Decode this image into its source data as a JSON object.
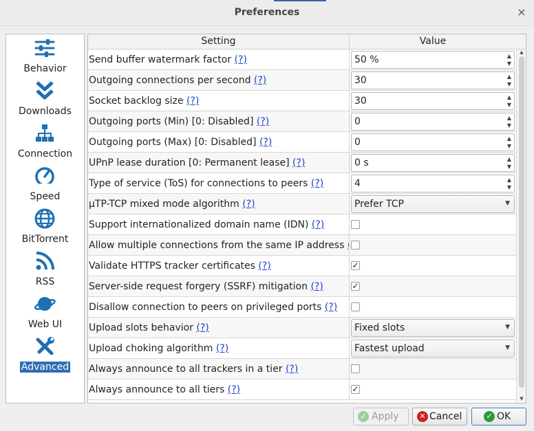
{
  "window": {
    "title": "Preferences",
    "close_glyph": "×"
  },
  "sidebar": {
    "items": [
      {
        "label": "Behavior",
        "icon": "sliders-icon"
      },
      {
        "label": "Downloads",
        "icon": "double-chevron-down-icon"
      },
      {
        "label": "Connection",
        "icon": "network-icon"
      },
      {
        "label": "Speed",
        "icon": "speedometer-icon"
      },
      {
        "label": "BitTorrent",
        "icon": "globe-icon"
      },
      {
        "label": "RSS",
        "icon": "rss-icon"
      },
      {
        "label": "Web UI",
        "icon": "planet-icon"
      },
      {
        "label": "Advanced",
        "icon": "tools-icon",
        "selected": true
      }
    ]
  },
  "table": {
    "headers": {
      "setting": "Setting",
      "value": "Value"
    },
    "help_link": "(?)",
    "rows": [
      {
        "label": "Send buffer watermark factor",
        "type": "spin",
        "value": "50 %"
      },
      {
        "label": "Outgoing connections per second",
        "type": "spin",
        "value": "30"
      },
      {
        "label": "Socket backlog size",
        "type": "spin",
        "value": "30"
      },
      {
        "label": "Outgoing ports (Min) [0: Disabled]",
        "type": "spin",
        "value": "0"
      },
      {
        "label": "Outgoing ports (Max) [0: Disabled]",
        "type": "spin",
        "value": "0"
      },
      {
        "label": "UPnP lease duration [0: Permanent lease]",
        "type": "spin",
        "value": "0 s"
      },
      {
        "label": "Type of service (ToS) for connections to peers",
        "type": "spin",
        "value": "4"
      },
      {
        "label": "µTP-TCP mixed mode algorithm",
        "type": "combo",
        "value": "Prefer TCP"
      },
      {
        "label": "Support internationalized domain name (IDN)",
        "type": "check",
        "value": ""
      },
      {
        "label": "Allow multiple connections from the same IP address",
        "type": "check",
        "value": ""
      },
      {
        "label": "Validate HTTPS tracker certificates",
        "type": "check",
        "value": "✓"
      },
      {
        "label": "Server-side request forgery (SSRF) mitigation",
        "type": "check",
        "value": "✓"
      },
      {
        "label": "Disallow connection to peers on privileged ports",
        "type": "check",
        "value": ""
      },
      {
        "label": "Upload slots behavior",
        "type": "combo",
        "value": "Fixed slots"
      },
      {
        "label": "Upload choking algorithm",
        "type": "combo",
        "value": "Fastest upload"
      },
      {
        "label": "Always announce to all trackers in a tier",
        "type": "check",
        "value": ""
      },
      {
        "label": "Always announce to all tiers",
        "type": "check",
        "value": "✓"
      }
    ]
  },
  "buttons": {
    "apply": "Apply",
    "cancel": "Cancel",
    "ok": "OK"
  },
  "colors": {
    "accent": "#2f6db5",
    "link": "#1a3fcc",
    "cancel_icon": "#cc1f1f",
    "ok_icon": "#2e9a3a"
  }
}
